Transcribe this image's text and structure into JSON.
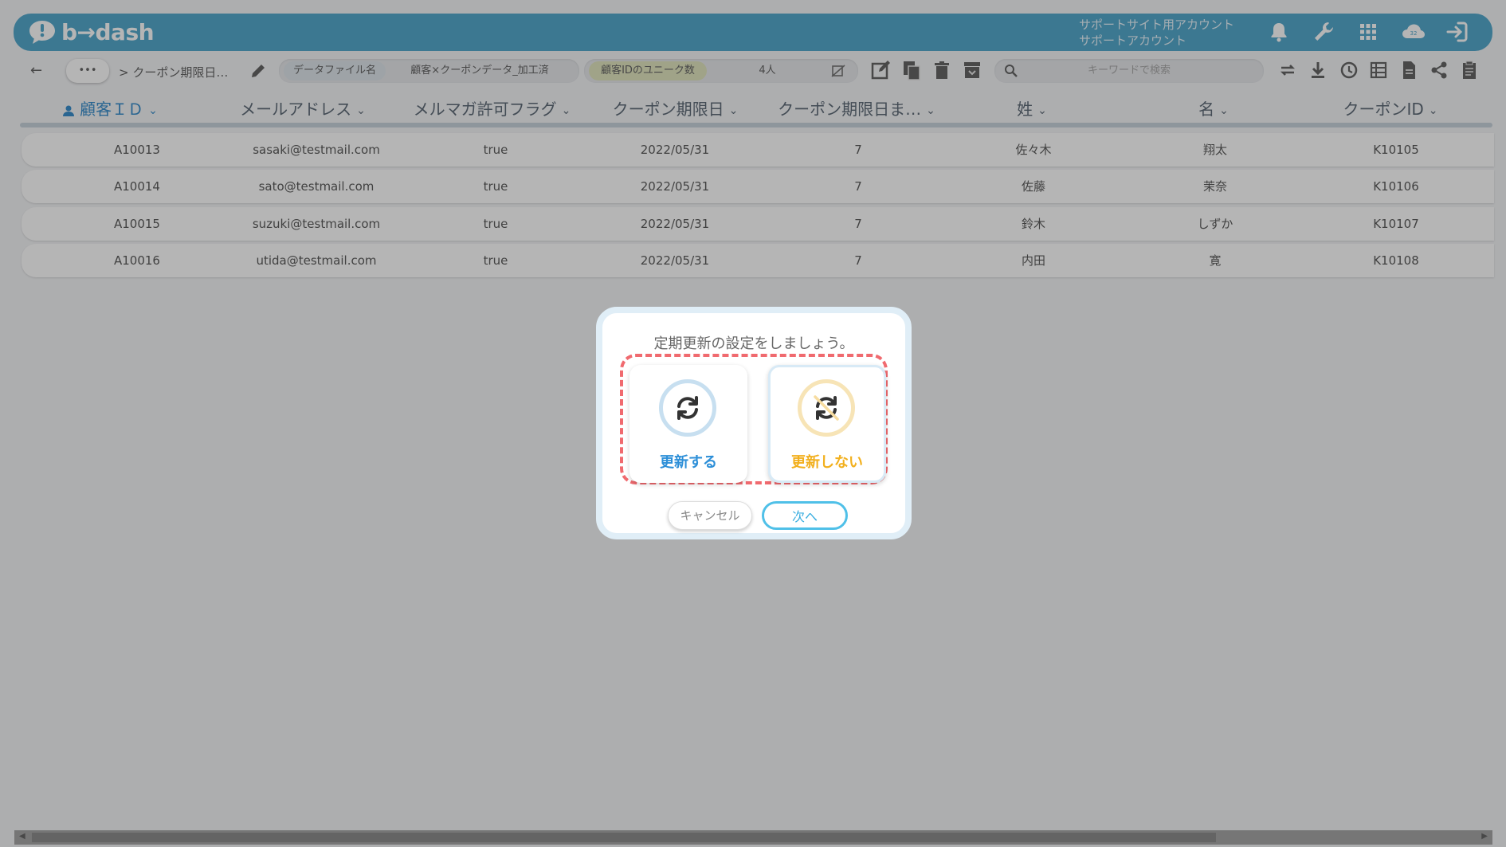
{
  "header": {
    "logo_text": "b→dash",
    "account_line1": "サポートサイト用アカウント",
    "account_line2": "サポートアカウント",
    "icons": [
      "bell-icon",
      "wrench-icon",
      "apps-grid-icon",
      "cloud-badge-icon",
      "sign-in-icon"
    ],
    "badge_count": "32"
  },
  "toolbar": {
    "more_label": "•••",
    "breadcrumb": "> クーポン期限日…",
    "data_file_label": "データファイル名",
    "data_file_value": "顧客×クーポンデータ_加工済",
    "unique_label": "顧客IDのユニーク数",
    "unique_value": "4人",
    "search_placeholder": "キーワードで検索"
  },
  "table": {
    "columns": [
      "顧客ＩＤ",
      "メールアドレス",
      "メルマガ許可フラグ",
      "クーポン期限日",
      "クーポン期限日ま…",
      "姓",
      "名",
      "クーポンID"
    ],
    "rows": [
      [
        "A10013",
        "sasaki@testmail.com",
        "true",
        "2022/05/31",
        "7",
        "佐々木",
        "翔太",
        "K10105"
      ],
      [
        "A10014",
        "sato@testmail.com",
        "true",
        "2022/05/31",
        "7",
        "佐藤",
        "茉奈",
        "K10106"
      ],
      [
        "A10015",
        "suzuki@testmail.com",
        "true",
        "2022/05/31",
        "7",
        "鈴木",
        "しずか",
        "K10107"
      ],
      [
        "A10016",
        "utida@testmail.com",
        "true",
        "2022/05/31",
        "7",
        "内田",
        "寛",
        "K10108"
      ]
    ]
  },
  "modal": {
    "title": "定期更新の設定をしましょう。",
    "option_update": "更新する",
    "option_no_update": "更新しない",
    "cancel": "キャンセル",
    "next": "次へ"
  },
  "colors": {
    "header": "#55a9cd",
    "update_blue": "#2d8fd8",
    "no_update_yellow": "#f2b01e",
    "dash_red": "#f06a6f",
    "next_border": "#4fc0e8"
  }
}
